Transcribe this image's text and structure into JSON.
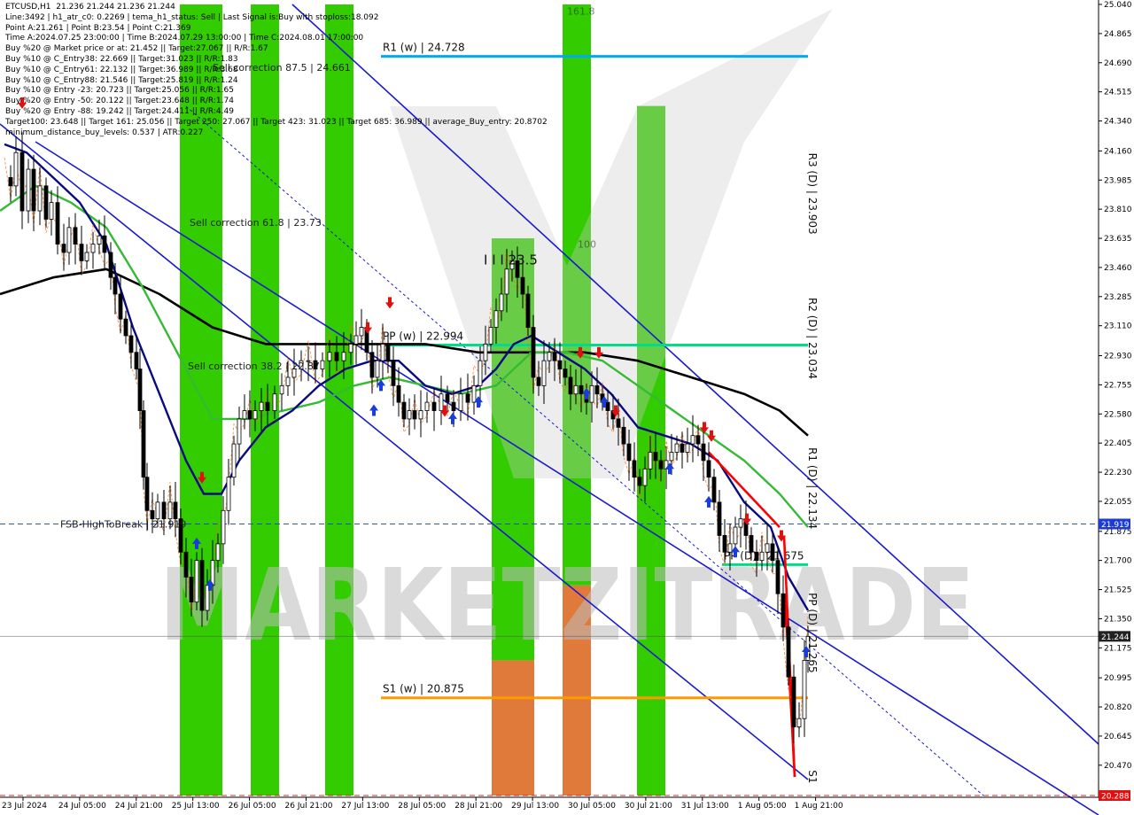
{
  "header": {
    "symbol": "ETCUSD,H1",
    "ohlc": "21.236 21.244 21.236 21.244",
    "lines": [
      "Line:3492 | h1_atr_c0: 0.2269 | tema_h1_status: Sell | Last Signal is:Buy with stoploss:18.092",
      "Point A:21.261 | Point B:23.54 | Point C:21.369",
      "Time A:2024.07.25 23:00:00 | Time B:2024.07.29 13:00:00 | Time C:2024.08.01 17:00:00",
      "Buy %20 @ Market price or at: 21.452 || Target:27.067 || R/R:1.67",
      "Buy %10 @ C_Entry38: 22.669 || Target:31.023 || R/R:1.83",
      "Buy %10 @ C_Entry61: 22.132 || Target:36.989 || R/R:3.68",
      "Buy %10 @ C_Entry88: 21.546 || Target:25.819 || R/R:1.24",
      "Buy %10 @ Entry -23: 20.723 || Target:25.056 || R/R:1.65",
      "Buy %20 @ Entry -50: 20.122 || Target:23.648 || R/R:1.74",
      "Buy %20 @ Entry -88: 19.242 || Target:24.411 || R/R:4.49",
      "Target100: 23.648 || Target 161: 25.056 || Target 250: 27.067 || Target 423: 31.023 || Target 685: 36.989 || average_Buy_entry: 20.8702",
      "minimum_distance_buy_levels: 0.537 | ATR:0.227"
    ]
  },
  "watermark": "MARKETZITRADE",
  "colors": {
    "background": "#ffffff",
    "bull_candle": "#000000",
    "bear_candle": "#000000",
    "green_zone": "#33cc00",
    "orange_zone": "#e07a3a",
    "channel": "#1a1acc",
    "r1_weekly": "#00aaee",
    "pivot": "#00dd88",
    "s1_weekly": "#ff9900",
    "ma_black": "#000000",
    "ma_green": "#33bb33",
    "ma_navy": "#0a0a80",
    "red_trend": "#ff0000",
    "price_label_blue": "#1e3cd2",
    "price_label_red": "#e01010",
    "arrow_up": "#1a3cd8",
    "arrow_down": "#e01010"
  },
  "chart_data": {
    "type": "candlestick",
    "y_range": [
      20.288,
      25.04
    ],
    "y_ticks": [
      "25.040",
      "24.865",
      "24.690",
      "24.515",
      "24.340",
      "24.160",
      "23.985",
      "23.810",
      "23.635",
      "23.460",
      "23.285",
      "23.110",
      "22.930",
      "22.755",
      "22.580",
      "22.405",
      "22.230",
      "22.055",
      "21.875",
      "21.700",
      "21.525",
      "21.350",
      "21.175",
      "20.995",
      "20.820",
      "20.645",
      "20.470"
    ],
    "x_labels": [
      "23 Jul 2024",
      "24 Jul 05:00",
      "24 Jul 21:00",
      "25 Jul 13:00",
      "26 Jul 05:00",
      "26 Jul 21:00",
      "27 Jul 13:00",
      "28 Jul 05:00",
      "28 Jul 21:00",
      "29 Jul 13:00",
      "30 Jul 05:00",
      "30 Jul 21:00",
      "31 Jul 13:00",
      "1 Aug 05:00",
      "1 Aug 21:00"
    ],
    "price_marks": [
      {
        "value": 21.919,
        "label": "21.919",
        "style": "blue"
      },
      {
        "value": 21.244,
        "label": "21.244",
        "style": "dark"
      },
      {
        "value": 20.288,
        "label": "20.288",
        "style": "red"
      }
    ],
    "levels": [
      {
        "name": "R1 (w) | 24.728",
        "value": 24.728,
        "x_from": 430,
        "x_to": 912,
        "color_key": "r1_weekly"
      },
      {
        "name": "PP (w) | 22.994",
        "value": 22.994,
        "x_from": 430,
        "x_to": 912,
        "color_key": "pivot"
      },
      {
        "name": "S1 (w) | 20.875",
        "value": 20.875,
        "x_from": 430,
        "x_to": 912,
        "color_key": "s1_weekly"
      },
      {
        "name": "PP (D) | 21.675",
        "value": 21.675,
        "x_from": 815,
        "x_to": 912,
        "color_key": "pivot"
      }
    ],
    "vertical_labels": [
      {
        "text": "R3 (D) | 23.903",
        "value": 23.903
      },
      {
        "text": "R2 (D) | 23.034",
        "value": 23.034
      },
      {
        "text": "R1 (D) | 22.134",
        "value": 22.134
      },
      {
        "text": "PP (D) | 21.265",
        "value": 21.265
      },
      {
        "text": "S1",
        "value": 20.4
      }
    ],
    "annotations": [
      {
        "text": "Sell correction 87.5 | 24.661",
        "value": 24.661
      },
      {
        "text": "Sell correction 61.8 | 23.73",
        "value": 23.73
      },
      {
        "text": "Sell correction 38.2 | 22.87",
        "value": 22.87
      },
      {
        "text": "FSB-HighToBreak | 21.919",
        "value": 21.919
      },
      {
        "text": "I I I 23.5",
        "value": 23.5
      },
      {
        "text": "100",
        "value": 23.6
      },
      {
        "text": "161.8",
        "value": 25.0
      }
    ],
    "zones": [
      {
        "x0": 203,
        "x1": 251,
        "kind": "green"
      },
      {
        "x0": 283,
        "x1": 315,
        "kind": "green"
      },
      {
        "x0": 367,
        "x1": 399,
        "kind": "green"
      },
      {
        "x0": 555,
        "x1": 603,
        "kind": "green",
        "top_value": 23.635,
        "split_value": 21.1
      },
      {
        "x0": 635,
        "x1": 667,
        "kind": "green",
        "split_value": 21.55
      },
      {
        "x0": 719,
        "x1": 751,
        "kind": "green",
        "top_value": 24.43
      }
    ],
    "close_path": [
      [
        5,
        24.0
      ],
      [
        12,
        23.95
      ],
      [
        18,
        24.15
      ],
      [
        25,
        23.8
      ],
      [
        32,
        24.05
      ],
      [
        38,
        23.8
      ],
      [
        45,
        23.95
      ],
      [
        52,
        23.75
      ],
      [
        58,
        23.85
      ],
      [
        65,
        23.6
      ],
      [
        72,
        23.55
      ],
      [
        78,
        23.7
      ],
      [
        85,
        23.6
      ],
      [
        92,
        23.5
      ],
      [
        98,
        23.55
      ],
      [
        105,
        23.6
      ],
      [
        112,
        23.65
      ],
      [
        118,
        23.55
      ],
      [
        125,
        23.4
      ],
      [
        130,
        23.3
      ],
      [
        136,
        23.15
      ],
      [
        142,
        23.05
      ],
      [
        148,
        22.95
      ],
      [
        154,
        22.85
      ],
      [
        158,
        22.6
      ],
      [
        162,
        22.2
      ],
      [
        166,
        22.0
      ],
      [
        172,
        21.95
      ],
      [
        178,
        22.05
      ],
      [
        185,
        21.95
      ],
      [
        192,
        22.05
      ],
      [
        198,
        21.95
      ],
      [
        204,
        21.75
      ],
      [
        210,
        21.6
      ],
      [
        216,
        21.45
      ],
      [
        222,
        21.7
      ],
      [
        228,
        21.4
      ],
      [
        234,
        21.55
      ],
      [
        240,
        21.7
      ],
      [
        246,
        21.8
      ],
      [
        252,
        22.0
      ],
      [
        258,
        22.2
      ],
      [
        264,
        22.4
      ],
      [
        270,
        22.55
      ],
      [
        276,
        22.6
      ],
      [
        282,
        22.55
      ],
      [
        288,
        22.6
      ],
      [
        295,
        22.65
      ],
      [
        302,
        22.6
      ],
      [
        310,
        22.7
      ],
      [
        318,
        22.75
      ],
      [
        325,
        22.8
      ],
      [
        332,
        22.85
      ],
      [
        340,
        22.9
      ],
      [
        348,
        22.9
      ],
      [
        356,
        22.85
      ],
      [
        364,
        22.9
      ],
      [
        372,
        22.95
      ],
      [
        380,
        22.9
      ],
      [
        388,
        22.95
      ],
      [
        396,
        23.0
      ],
      [
        402,
        23.05
      ],
      [
        408,
        23.1
      ],
      [
        414,
        22.95
      ],
      [
        420,
        22.8
      ],
      [
        426,
        22.9
      ],
      [
        432,
        23.0
      ],
      [
        438,
        22.9
      ],
      [
        444,
        22.75
      ],
      [
        450,
        22.65
      ],
      [
        456,
        22.55
      ],
      [
        462,
        22.6
      ],
      [
        468,
        22.55
      ],
      [
        475,
        22.6
      ],
      [
        482,
        22.65
      ],
      [
        490,
        22.6
      ],
      [
        498,
        22.7
      ],
      [
        505,
        22.65
      ],
      [
        512,
        22.6
      ],
      [
        520,
        22.7
      ],
      [
        528,
        22.65
      ],
      [
        535,
        22.75
      ],
      [
        542,
        22.9
      ],
      [
        548,
        23.0
      ],
      [
        554,
        23.1
      ],
      [
        560,
        23.2
      ],
      [
        566,
        23.3
      ],
      [
        572,
        23.45
      ],
      [
        578,
        23.5
      ],
      [
        584,
        23.4
      ],
      [
        590,
        23.3
      ],
      [
        596,
        23.1
      ],
      [
        602,
        22.8
      ],
      [
        608,
        22.75
      ],
      [
        614,
        22.9
      ],
      [
        620,
        22.95
      ],
      [
        626,
        22.9
      ],
      [
        632,
        22.85
      ],
      [
        638,
        22.8
      ],
      [
        644,
        22.7
      ],
      [
        650,
        22.75
      ],
      [
        656,
        22.7
      ],
      [
        662,
        22.65
      ],
      [
        668,
        22.75
      ],
      [
        674,
        22.7
      ],
      [
        680,
        22.65
      ],
      [
        686,
        22.6
      ],
      [
        692,
        22.55
      ],
      [
        698,
        22.5
      ],
      [
        704,
        22.4
      ],
      [
        710,
        22.3
      ],
      [
        716,
        22.2
      ],
      [
        722,
        22.15
      ],
      [
        728,
        22.25
      ],
      [
        734,
        22.35
      ],
      [
        740,
        22.3
      ],
      [
        746,
        22.25
      ],
      [
        752,
        22.3
      ],
      [
        758,
        22.35
      ],
      [
        764,
        22.4
      ],
      [
        770,
        22.35
      ],
      [
        776,
        22.4
      ],
      [
        782,
        22.45
      ],
      [
        788,
        22.4
      ],
      [
        794,
        22.3
      ],
      [
        800,
        22.2
      ],
      [
        806,
        22.05
      ],
      [
        812,
        21.85
      ],
      [
        818,
        21.75
      ],
      [
        824,
        21.8
      ],
      [
        830,
        21.9
      ],
      [
        836,
        21.95
      ],
      [
        842,
        21.85
      ],
      [
        848,
        21.75
      ],
      [
        854,
        21.7
      ],
      [
        860,
        21.75
      ],
      [
        866,
        21.8
      ],
      [
        872,
        21.7
      ],
      [
        878,
        21.5
      ],
      [
        884,
        21.3
      ],
      [
        890,
        21.0
      ],
      [
        896,
        20.7
      ],
      [
        902,
        20.75
      ],
      [
        908,
        21.1
      ],
      [
        912,
        21.244
      ]
    ],
    "ma_black": [
      [
        0,
        23.3
      ],
      [
        60,
        23.4
      ],
      [
        120,
        23.45
      ],
      [
        180,
        23.3
      ],
      [
        240,
        23.1
      ],
      [
        300,
        23.0
      ],
      [
        360,
        23.0
      ],
      [
        420,
        23.0
      ],
      [
        480,
        23.0
      ],
      [
        540,
        22.95
      ],
      [
        600,
        22.95
      ],
      [
        660,
        22.95
      ],
      [
        720,
        22.9
      ],
      [
        780,
        22.8
      ],
      [
        840,
        22.7
      ],
      [
        880,
        22.6
      ],
      [
        912,
        22.45
      ]
    ],
    "ma_green": [
      [
        0,
        23.8
      ],
      [
        40,
        23.95
      ],
      [
        80,
        23.85
      ],
      [
        120,
        23.7
      ],
      [
        160,
        23.35
      ],
      [
        200,
        22.95
      ],
      [
        240,
        22.55
      ],
      [
        280,
        22.55
      ],
      [
        320,
        22.6
      ],
      [
        360,
        22.65
      ],
      [
        400,
        22.75
      ],
      [
        440,
        22.8
      ],
      [
        480,
        22.75
      ],
      [
        520,
        22.7
      ],
      [
        560,
        22.75
      ],
      [
        600,
        22.95
      ],
      [
        640,
        22.95
      ],
      [
        680,
        22.9
      ],
      [
        720,
        22.75
      ],
      [
        760,
        22.6
      ],
      [
        800,
        22.45
      ],
      [
        840,
        22.3
      ],
      [
        880,
        22.1
      ],
      [
        912,
        21.9
      ]
    ],
    "ma_navy": [
      [
        5,
        24.2
      ],
      [
        30,
        24.15
      ],
      [
        60,
        24.0
      ],
      [
        90,
        23.85
      ],
      [
        120,
        23.6
      ],
      [
        150,
        23.1
      ],
      [
        180,
        22.7
      ],
      [
        210,
        22.3
      ],
      [
        230,
        22.1
      ],
      [
        250,
        22.1
      ],
      [
        270,
        22.3
      ],
      [
        300,
        22.5
      ],
      [
        330,
        22.6
      ],
      [
        360,
        22.75
      ],
      [
        390,
        22.85
      ],
      [
        420,
        22.9
      ],
      [
        450,
        22.9
      ],
      [
        480,
        22.75
      ],
      [
        510,
        22.7
      ],
      [
        540,
        22.75
      ],
      [
        560,
        22.85
      ],
      [
        580,
        23.0
      ],
      [
        600,
        23.05
      ],
      [
        630,
        22.95
      ],
      [
        660,
        22.85
      ],
      [
        690,
        22.7
      ],
      [
        720,
        22.5
      ],
      [
        750,
        22.45
      ],
      [
        780,
        22.4
      ],
      [
        810,
        22.3
      ],
      [
        840,
        22.05
      ],
      [
        870,
        21.9
      ],
      [
        890,
        21.6
      ],
      [
        912,
        21.4
      ]
    ],
    "red_segments": [
      [
        [
          800,
          22.35
        ],
        [
          880,
          21.9
        ]
      ],
      [
        [
          885,
          21.85
        ],
        [
          897,
          20.4
        ]
      ],
      [
        [
          886,
          21.5
        ],
        [
          897,
          20.4
        ]
      ]
    ]
  }
}
